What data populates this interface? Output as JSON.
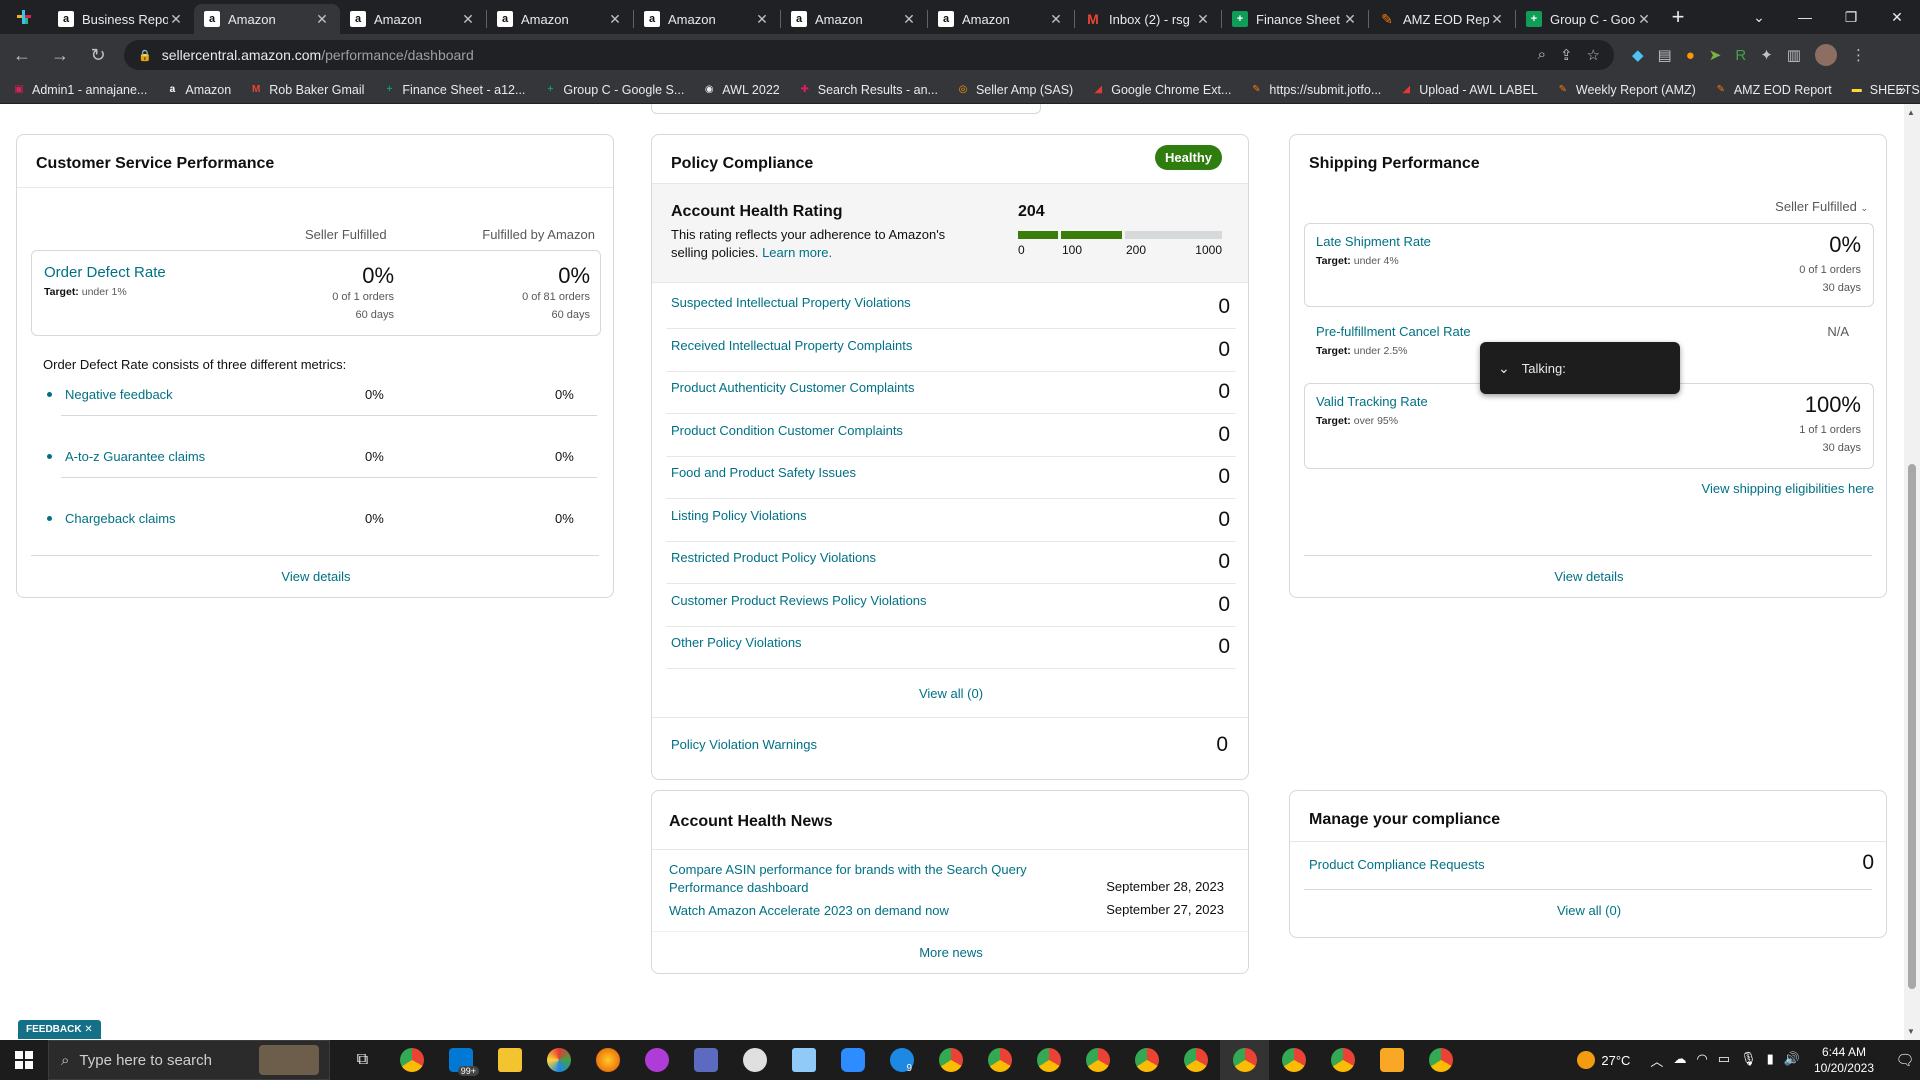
{
  "browser": {
    "tabs": [
      {
        "title": "Business Repo",
        "favicon": "amazon-icon",
        "active": false
      },
      {
        "title": "Amazon",
        "favicon": "amazon-icon",
        "active": true
      },
      {
        "title": "Amazon",
        "favicon": "amazon-icon",
        "active": false
      },
      {
        "title": "Amazon",
        "favicon": "amazon-icon",
        "active": false
      },
      {
        "title": "Amazon",
        "favicon": "amazon-icon",
        "active": false
      },
      {
        "title": "Amazon",
        "favicon": "amazon-icon",
        "active": false
      },
      {
        "title": "Amazon",
        "favicon": "amazon-icon",
        "active": false
      },
      {
        "title": "Inbox (2) - rsg",
        "favicon": "gmail-icon",
        "active": false
      },
      {
        "title": "Finance Sheet",
        "favicon": "sheets-icon",
        "active": false
      },
      {
        "title": "AMZ EOD Rep",
        "favicon": "jotform-icon",
        "active": false
      },
      {
        "title": "Group C - Goo",
        "favicon": "sheets-icon",
        "active": false
      }
    ],
    "url_host": "sellercentral.amazon.com",
    "url_path": "/performance/dashboard",
    "bookmarks": [
      "Admin1 - annajane...",
      "Amazon",
      "Rob Baker Gmail",
      "Finance Sheet - a12...",
      "Group C - Google S...",
      "AWL 2022",
      "Search Results - an...",
      "Seller Amp (SAS)",
      "Google Chrome Ext...",
      "https://submit.jotfo...",
      "Upload - AWL LABEL",
      "Weekly Report (AMZ)",
      "AMZ EOD Report",
      "SHEETS"
    ],
    "bookmarks_more": "»"
  },
  "customer_service": {
    "title": "Customer Service Performance",
    "col_seller": "Seller Fulfilled",
    "col_fba": "Fulfilled by Amazon",
    "odr_label": "Order Defect Rate",
    "odr_target_label": "Target:",
    "odr_target_value": "under 1%",
    "seller_value": "0%",
    "seller_orders": "0 of 1 orders",
    "seller_days": "60 days",
    "fba_value": "0%",
    "fba_orders": "0 of 81 orders",
    "fba_days": "60 days",
    "consists_text": "Order Defect Rate consists of three different metrics:",
    "metrics": [
      {
        "name": "Negative feedback",
        "seller": "0%",
        "fba": "0%"
      },
      {
        "name": "A-to-z Guarantee claims",
        "seller": "0%",
        "fba": "0%"
      },
      {
        "name": "Chargeback claims",
        "seller": "0%",
        "fba": "0%"
      }
    ],
    "view_details": "View details"
  },
  "policy": {
    "title": "Policy Compliance",
    "status": "Healthy",
    "ahr_title": "Account Health Rating",
    "ahr_desc": "This rating reflects your adherence to Amazon's selling policies.",
    "learn_more": "Learn more.",
    "score": "204",
    "score_value": 204,
    "ticks": [
      "0",
      "100",
      "200",
      "1000"
    ],
    "rows": [
      {
        "name": "Suspected Intellectual Property Violations",
        "count": "0"
      },
      {
        "name": "Received Intellectual Property Complaints",
        "count": "0"
      },
      {
        "name": "Product Authenticity Customer Complaints",
        "count": "0"
      },
      {
        "name": "Product Condition Customer Complaints",
        "count": "0"
      },
      {
        "name": "Food and Product Safety Issues",
        "count": "0"
      },
      {
        "name": "Listing Policy Violations",
        "count": "0"
      },
      {
        "name": "Restricted Product Policy Violations",
        "count": "0"
      },
      {
        "name": "Customer Product Reviews Policy Violations",
        "count": "0"
      },
      {
        "name": "Other Policy Violations",
        "count": "0"
      }
    ],
    "view_all": "View all (0)",
    "warnings_label": "Policy Violation Warnings",
    "warnings_count": "0",
    "colors": {
      "healthy": "#2e7d0e",
      "bar_fill": "#3a7d0a",
      "bar_empty": "#d5d9d9"
    }
  },
  "news": {
    "title": "Account Health News",
    "items": [
      {
        "text": "Compare ASIN performance for brands with the Search Query Performance dashboard",
        "date": "September 28, 2023"
      },
      {
        "text": "Watch Amazon Accelerate 2023 on demand now",
        "date": "September 27, 2023"
      }
    ],
    "more": "More news"
  },
  "shipping": {
    "title": "Shipping Performance",
    "filter": "Seller Fulfilled",
    "metrics": [
      {
        "name": "Late Shipment Rate",
        "target_label": "Target:",
        "target": "under 4%",
        "value": "0%",
        "orders": "0 of 1 orders",
        "days": "30 days"
      },
      {
        "name": "Pre-fulfillment Cancel Rate",
        "target_label": "Target:",
        "target": "under 2.5%",
        "value": "N/A",
        "orders": "",
        "days": ""
      },
      {
        "name": "Valid Tracking Rate",
        "target_label": "Target:",
        "target": "over 95%",
        "value": "100%",
        "orders": "1 of 1 orders",
        "days": "30 days"
      }
    ],
    "eligibilities": "View shipping eligibilities here",
    "view_details": "View details"
  },
  "compliance": {
    "title": "Manage your compliance",
    "requests_label": "Product Compliance Requests",
    "requests_count": "0",
    "view_all": "View all (0)"
  },
  "overlay": {
    "talking": "Talking:"
  },
  "feedback": "FEEDBACK",
  "feedback_close": "✕",
  "taskbar": {
    "search_placeholder": "Type here to search",
    "temperature": "27°C",
    "time": "6:44 AM",
    "date": "10/20/2023",
    "mail_badge": "99+",
    "edge_badge": "9"
  }
}
